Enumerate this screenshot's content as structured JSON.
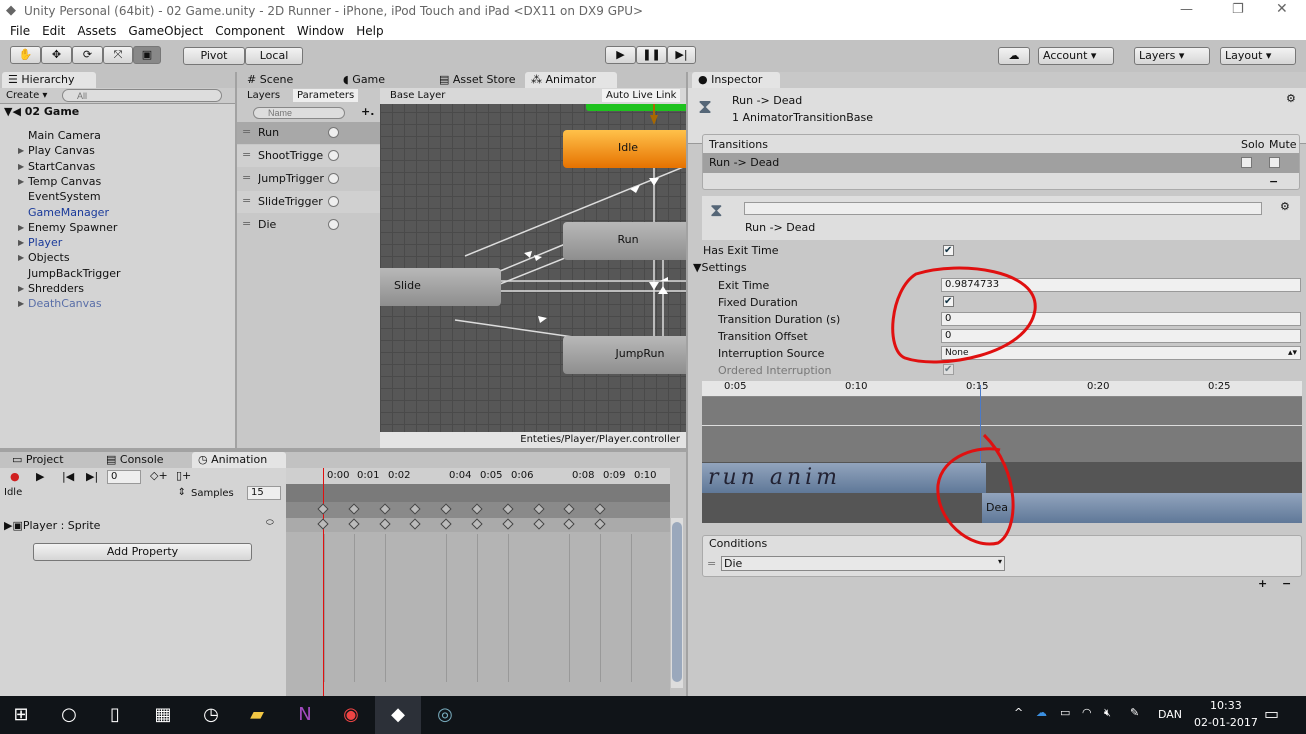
{
  "window": {
    "title": "Unity Personal (64bit) - 02 Game.unity - 2D Runner - iPhone, iPod Touch and iPad <DX11 on DX9 GPU>"
  },
  "menu": [
    "File",
    "Edit",
    "Assets",
    "GameObject",
    "Component",
    "Window",
    "Help"
  ],
  "toolbar": {
    "pivot": "Pivot",
    "local": "Local",
    "account": "Account",
    "layers": "Layers",
    "layout": "Layout"
  },
  "hierarchy": {
    "tab": "Hierarchy",
    "create": "Create",
    "search_placeholder": "All",
    "scene": "02 Game",
    "items": [
      {
        "label": "Main Camera",
        "arrow": false,
        "color": "#111"
      },
      {
        "label": "Play Canvas",
        "arrow": true,
        "color": "#111"
      },
      {
        "label": "StartCanvas",
        "arrow": true,
        "color": "#111"
      },
      {
        "label": "Temp Canvas",
        "arrow": true,
        "color": "#111"
      },
      {
        "label": "EventSystem",
        "arrow": false,
        "color": "#111"
      },
      {
        "label": "GameManager",
        "arrow": false,
        "color": "#1a3a9a"
      },
      {
        "label": "Enemy Spawner",
        "arrow": true,
        "color": "#111"
      },
      {
        "label": "Player",
        "arrow": true,
        "color": "#1a3a9a"
      },
      {
        "label": "Objects",
        "arrow": true,
        "color": "#111"
      },
      {
        "label": "JumpBackTrigger",
        "arrow": false,
        "color": "#111"
      },
      {
        "label": "Shredders",
        "arrow": true,
        "color": "#111"
      },
      {
        "label": "DeathCanvas",
        "arrow": true,
        "color": "#5a6fa8"
      }
    ]
  },
  "center_tabs": [
    "Scene",
    "Game",
    "Asset Store",
    "Animator"
  ],
  "animator": {
    "layers_tab": "Layers",
    "parameters_tab": "Parameters",
    "search_placeholder": "Name",
    "breadcrumb": "Base Layer",
    "auto_live_link": "Auto Live Link",
    "parameters": [
      "Run",
      "ShootTrigge",
      "JumpTrigger",
      "SlideTrigger",
      "Die"
    ],
    "states": {
      "idle": "Idle",
      "run": "Run",
      "slide": "Slide",
      "jumprun": "JumpRun"
    },
    "controller_path": "Enteties/Player/Player.controller",
    "default_state_color": "#f08c00"
  },
  "inspector": {
    "tab": "Inspector",
    "title": "Run -> Dead",
    "subtitle": "1 AnimatorTransitionBase",
    "transitions_header": "Transitions",
    "solo": "Solo",
    "mute": "Mute",
    "transition_row": "Run -> Dead",
    "transition_name": "Run -> Dead",
    "has_exit_time": "Has Exit Time",
    "settings": "Settings",
    "fields": [
      {
        "label": "Exit Time",
        "value": "0.9874733"
      },
      {
        "label": "Fixed Duration",
        "value": ""
      },
      {
        "label": "Transition Duration (s)",
        "value": "0"
      },
      {
        "label": "Transition Offset",
        "value": "0"
      },
      {
        "label": "Interruption Source",
        "value": "None"
      },
      {
        "label": "Ordered Interruption",
        "value": ""
      }
    ],
    "timeline_ticks": [
      "0:05",
      "0:10",
      "0:15",
      "0:20",
      "0:25"
    ],
    "clip_from_handwritten": "run anim",
    "clip_to": "Dea",
    "conditions_header": "Conditions",
    "condition": "Die"
  },
  "animation": {
    "tabs": [
      "Project",
      "Console",
      "Animation"
    ],
    "frame": "0",
    "clip": "Idle",
    "samples_label": "Samples",
    "samples": "15",
    "track": "Player : Sprite",
    "add_property": "Add Property",
    "ticks": [
      "0:00",
      "0:01",
      "0:02",
      "0:04",
      "0:05",
      "0:06",
      "0:08",
      "0:09",
      "0:10"
    ],
    "keyframes": 10
  },
  "taskbar": {
    "language": "DAN",
    "time": "10:33",
    "date": "02-01-2017"
  },
  "annotation_color": "#e01010"
}
